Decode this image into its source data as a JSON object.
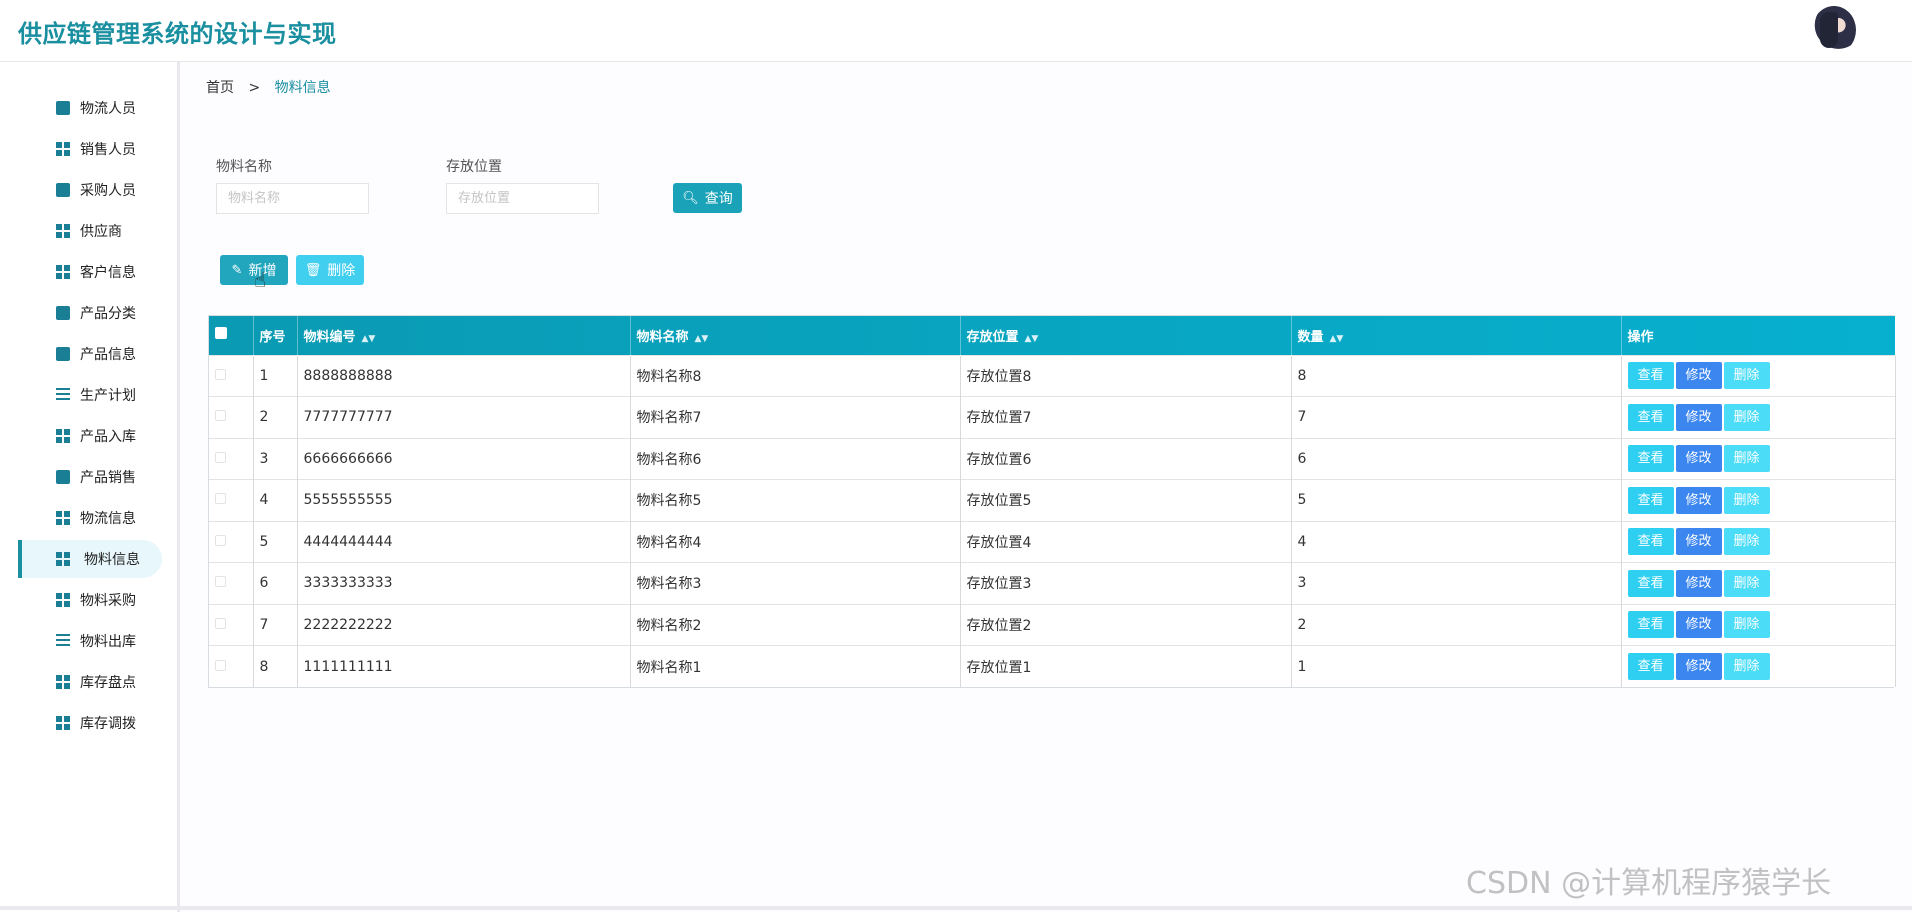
{
  "header": {
    "title": "供应链管理系统的设计与实现"
  },
  "sidebar": {
    "items": [
      {
        "label": "物流人员",
        "icon": "clipboard-icon"
      },
      {
        "label": "销售人员",
        "icon": "grid-icon"
      },
      {
        "label": "采购人员",
        "icon": "briefcase-icon"
      },
      {
        "label": "供应商",
        "icon": "grid-icon"
      },
      {
        "label": "客户信息",
        "icon": "grid-icon"
      },
      {
        "label": "产品分类",
        "icon": "clipboard-icon"
      },
      {
        "label": "产品信息",
        "icon": "monitor-icon"
      },
      {
        "label": "生产计划",
        "icon": "list-icon"
      },
      {
        "label": "产品入库",
        "icon": "grid-icon"
      },
      {
        "label": "产品销售",
        "icon": "flag-icon"
      },
      {
        "label": "物流信息",
        "icon": "grid-icon"
      },
      {
        "label": "物料信息",
        "icon": "grid-icon",
        "active": true
      },
      {
        "label": "物料采购",
        "icon": "grid-icon"
      },
      {
        "label": "物料出库",
        "icon": "list-icon"
      },
      {
        "label": "库存盘点",
        "icon": "grid-icon"
      },
      {
        "label": "库存调拨",
        "icon": "grid-icon"
      }
    ]
  },
  "breadcrumb": {
    "home": "首页",
    "separator": ">",
    "current": "物料信息"
  },
  "search": {
    "name_label": "物料名称",
    "name_placeholder": "物料名称",
    "location_label": "存放位置",
    "location_placeholder": "存放位置",
    "query_label": "查询"
  },
  "toolbar": {
    "add_label": "新增",
    "delete_label": "删除"
  },
  "table": {
    "headers": {
      "index": "序号",
      "code": "物料编号",
      "name": "物料名称",
      "location": "存放位置",
      "quantity": "数量",
      "actions": "操作"
    },
    "rows": [
      {
        "index": "1",
        "code": "8888888888",
        "name": "物料名称8",
        "location": "存放位置8",
        "quantity": "8"
      },
      {
        "index": "2",
        "code": "7777777777",
        "name": "物料名称7",
        "location": "存放位置7",
        "quantity": "7"
      },
      {
        "index": "3",
        "code": "6666666666",
        "name": "物料名称6",
        "location": "存放位置6",
        "quantity": "6"
      },
      {
        "index": "4",
        "code": "5555555555",
        "name": "物料名称5",
        "location": "存放位置5",
        "quantity": "5"
      },
      {
        "index": "5",
        "code": "4444444444",
        "name": "物料名称4",
        "location": "存放位置4",
        "quantity": "4"
      },
      {
        "index": "6",
        "code": "3333333333",
        "name": "物料名称3",
        "location": "存放位置3",
        "quantity": "3"
      },
      {
        "index": "7",
        "code": "2222222222",
        "name": "物料名称2",
        "location": "存放位置2",
        "quantity": "2"
      },
      {
        "index": "8",
        "code": "1111111111",
        "name": "物料名称1",
        "location": "存放位置1",
        "quantity": "1"
      }
    ],
    "action_labels": {
      "view": "查看",
      "edit": "修改",
      "delete": "删除"
    }
  },
  "watermark": "CSDN @计算机程序猿学长",
  "colors": {
    "accent": "#1a8fa0",
    "header_gradient_start": "#0a9ab3",
    "header_gradient_end": "#07b0cf",
    "view_button": "#2ecff0",
    "edit_button": "#3c86f0",
    "delete_button": "#4bdcf7"
  }
}
